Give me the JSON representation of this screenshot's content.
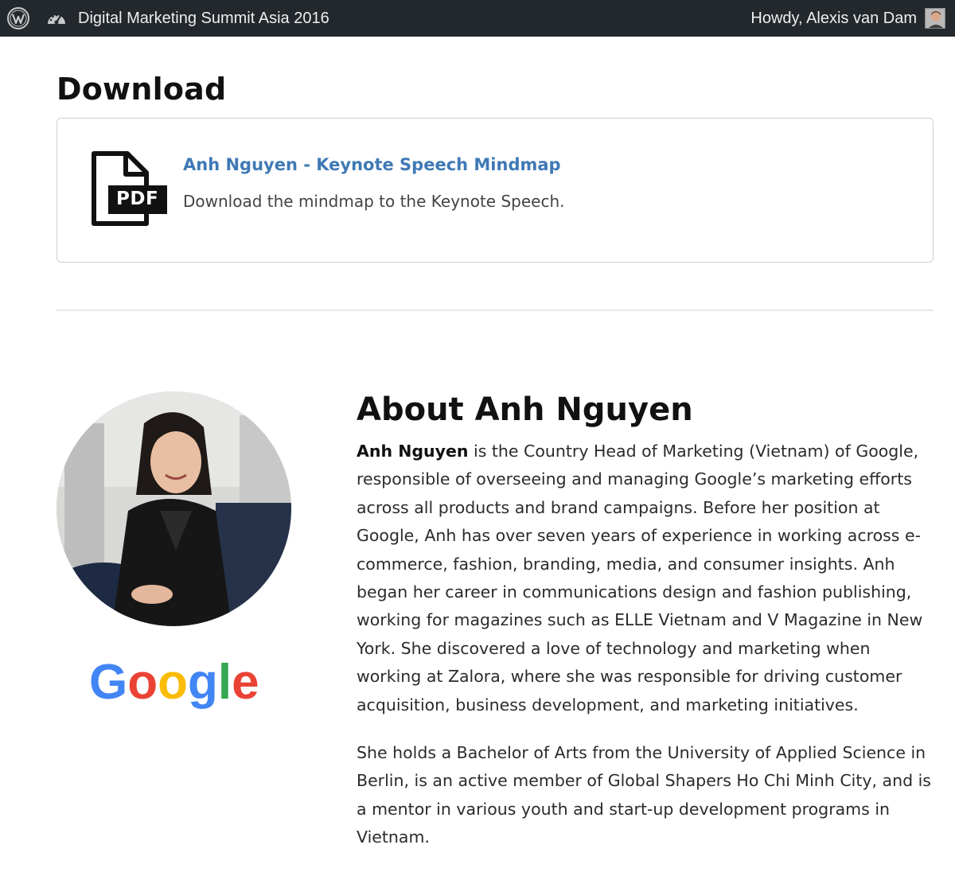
{
  "adminbar": {
    "site_name": "Digital Marketing Summit Asia 2016",
    "howdy": "Howdy, Alexis van Dam",
    "icons": [
      "wordpress-icon",
      "dashboard-icon",
      "avatar"
    ],
    "bg_color": "#23282d"
  },
  "page": {
    "title": "Download"
  },
  "download": {
    "file_badge": "PDF",
    "title": "Anh Nguyen - Keynote Speech Mindmap",
    "description": "Download the mindmap to the Keynote Speech.",
    "link_color": "#3f79b5"
  },
  "about": {
    "title": "About Anh Nguyen",
    "name": "Anh Nguyen",
    "p1_rest": " is the Country Head of Marketing (Vietnam) of Google, responsible of overseeing and managing Google’s marketing efforts across all products and brand campaigns. Before her position at Google, Anh has over seven years of experience in working across e-commerce, fashion, branding, media, and consumer insights. Anh began her career in communications design and fashion publishing, working for magazines such as ELLE Vietnam and V Magazine in New York. She discovered a love of technology and marketing when working at Zalora, where she was responsible for driving customer acquisition, business development, and marketing initiatives.",
    "p2": "She holds a Bachelor of Arts from the University of Applied Science in Berlin, is an active member of Global Shapers Ho Chi Minh City, and is a mentor in various youth and start-up development programs in Vietnam.",
    "company_logo": "Google"
  }
}
